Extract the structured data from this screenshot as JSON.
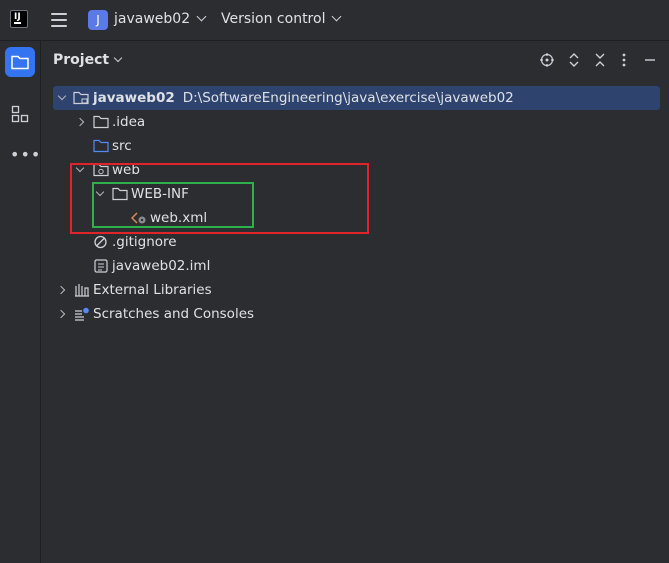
{
  "titlebar": {
    "project_badge": "J",
    "project_name": "javaweb02",
    "vcs_label": "Version control"
  },
  "panel": {
    "title": "Project"
  },
  "tree": {
    "root": {
      "name": "javaweb02",
      "path": "D:\\SoftwareEngineering\\java\\exercise\\javaweb02"
    },
    "idea": ".idea",
    "src": "src",
    "web": "web",
    "webinf": "WEB-INF",
    "webxml": "web.xml",
    "gitignore": ".gitignore",
    "iml": "javaweb02.iml",
    "external": "External Libraries",
    "scratches": "Scratches and Consoles"
  },
  "colors": {
    "accent": "#3574f0",
    "selection": "#2e436e",
    "highlight_red": "#e0242b",
    "highlight_green": "#2fb04a"
  },
  "icons": [
    "hamburger-icon",
    "folder-icon",
    "structure-icon",
    "more-icon",
    "locate-icon",
    "expand-icon",
    "collapse-icon",
    "options-icon",
    "minimize-icon",
    "xml-file-icon",
    "gitignore-icon",
    "iml-file-icon",
    "library-icon",
    "scratches-icon"
  ]
}
